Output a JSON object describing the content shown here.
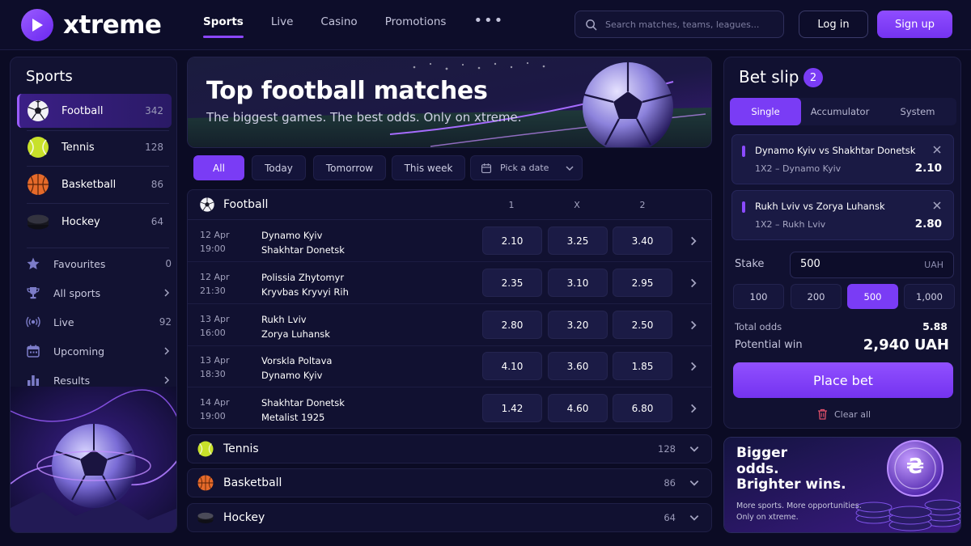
{
  "brand": {
    "name": "xtreme"
  },
  "nav": {
    "items": [
      {
        "label": "Sports",
        "active": true
      },
      {
        "label": "Live",
        "active": false
      },
      {
        "label": "Casino",
        "active": false
      },
      {
        "label": "Promotions",
        "active": false
      }
    ],
    "more": "•••"
  },
  "search": {
    "placeholder": "Search matches, teams, leagues..."
  },
  "auth": {
    "login": "Log in",
    "signup": "Sign up"
  },
  "sidebar": {
    "title": "Sports",
    "sports": [
      {
        "label": "Football",
        "count": "342",
        "icon": "football-icon",
        "active": true
      },
      {
        "label": "Tennis",
        "count": "128",
        "icon": "tennis-ball-icon",
        "active": false
      },
      {
        "label": "Basketball",
        "count": "86",
        "icon": "basketball-icon",
        "active": false
      },
      {
        "label": "Hockey",
        "count": "64",
        "icon": "hockey-puck-icon",
        "active": false
      }
    ],
    "links": [
      {
        "label": "Favourites",
        "count": "0",
        "icon": "star-icon"
      },
      {
        "label": "All sports",
        "icon": "trophy-icon",
        "chevron": true
      },
      {
        "label": "Live",
        "count": "92",
        "icon": "live-signal-icon"
      },
      {
        "label": "Upcoming",
        "icon": "calendar-icon",
        "chevron": true
      },
      {
        "label": "Results",
        "icon": "bar-chart-icon",
        "chevron": true
      }
    ]
  },
  "banner": {
    "title": "Top football matches",
    "subtitle": "The biggest games. The best odds. Only on xtreme."
  },
  "filters": {
    "items": [
      {
        "label": "All",
        "active": true
      },
      {
        "label": "Today",
        "active": false
      },
      {
        "label": "Tomorrow",
        "active": false
      },
      {
        "label": "This week",
        "active": false
      }
    ],
    "date_picker": "Pick a date"
  },
  "football": {
    "title": "Football",
    "columns": [
      "1",
      "X",
      "2"
    ],
    "matches": [
      {
        "date": "12 Apr",
        "time": "19:00",
        "home": "Dynamo Kyiv",
        "away": "Shakhtar Donetsk",
        "odds": [
          "2.10",
          "3.25",
          "3.40"
        ]
      },
      {
        "date": "12 Apr",
        "time": "21:30",
        "home": "Polissia Zhytomyr",
        "away": "Kryvbas Kryvyi Rih",
        "odds": [
          "2.35",
          "3.10",
          "2.95"
        ]
      },
      {
        "date": "13 Apr",
        "time": "16:00",
        "home": "Rukh Lviv",
        "away": "Zorya Luhansk",
        "odds": [
          "2.80",
          "3.20",
          "2.50"
        ]
      },
      {
        "date": "13 Apr",
        "time": "18:30",
        "home": "Vorskla Poltava",
        "away": "Dynamo Kyiv",
        "odds": [
          "4.10",
          "3.60",
          "1.85"
        ]
      },
      {
        "date": "14 Apr",
        "time": "19:00",
        "home": "Shakhtar Donetsk",
        "away": "Metalist 1925",
        "odds": [
          "1.42",
          "4.60",
          "6.80"
        ]
      }
    ]
  },
  "categories": [
    {
      "label": "Tennis",
      "count": "128",
      "icon": "tennis-ball-icon"
    },
    {
      "label": "Basketball",
      "count": "86",
      "icon": "basketball-icon"
    },
    {
      "label": "Hockey",
      "count": "64",
      "icon": "hockey-puck-icon"
    }
  ],
  "betslip": {
    "title": "Bet slip",
    "count": "2",
    "tabs": [
      {
        "label": "Single",
        "active": true
      },
      {
        "label": "Accumulator",
        "active": false
      },
      {
        "label": "System",
        "active": false
      }
    ],
    "selections": [
      {
        "match": "Dynamo Kyiv vs Shakhtar Donetsk",
        "pick": "1X2 – Dynamo Kyiv",
        "odds": "2.10"
      },
      {
        "match": "Rukh Lviv vs Zorya Luhansk",
        "pick": "1X2 – Rukh Lviv",
        "odds": "2.80"
      }
    ],
    "stake_label": "Stake",
    "stake_value": "500",
    "currency": "UAH",
    "quick_stakes": [
      {
        "label": "100",
        "active": false
      },
      {
        "label": "200",
        "active": false
      },
      {
        "label": "500",
        "active": true
      },
      {
        "label": "1,000",
        "active": false
      }
    ],
    "total_odds_label": "Total odds",
    "total_odds": "5.88",
    "potential_win_label": "Potential win",
    "potential_win": "2,940 UAH",
    "place_bet": "Place bet",
    "clear_all": "Clear all"
  },
  "promo": {
    "title_lines": [
      "Bigger",
      "odds.",
      "Brighter wins."
    ],
    "subtitle_lines": [
      "More sports. More opportunities.",
      "Only on xtreme."
    ],
    "coin_symbol": "₴"
  },
  "colors": {
    "accent": "#7a3cf5",
    "background": "#0b0b24",
    "panel": "#111131"
  }
}
